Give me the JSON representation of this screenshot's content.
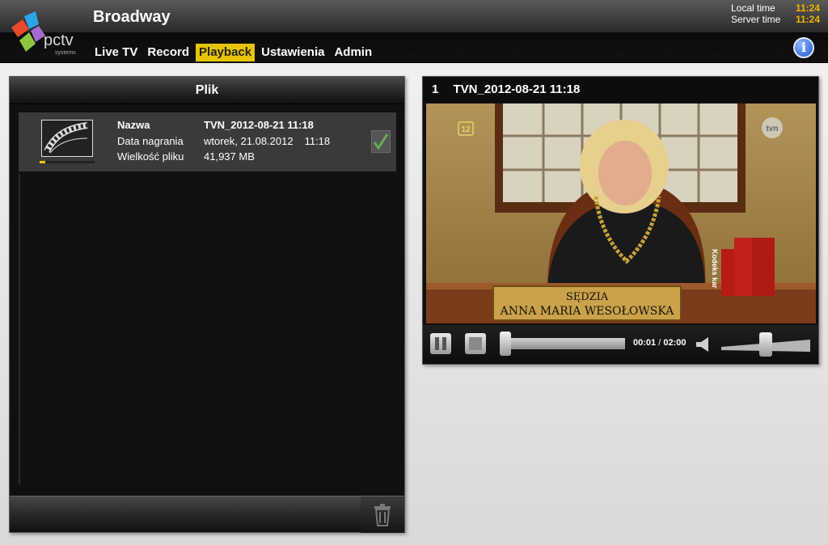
{
  "app": {
    "title": "Broadway",
    "logo_text": "pctv",
    "logo_subtext": "systems"
  },
  "clock": {
    "local_label": "Local time",
    "local_value": "11:24",
    "server_label": "Server time",
    "server_value": "11:24"
  },
  "nav": {
    "items": [
      {
        "label": "Live TV"
      },
      {
        "label": "Record"
      },
      {
        "label": "Playback",
        "active": true
      },
      {
        "label": "Ustawienia"
      },
      {
        "label": "Admin"
      }
    ]
  },
  "file_panel": {
    "title": "Plik",
    "file": {
      "name_label": "Nazwa",
      "name_value": "TVN_2012-08-21 11:18",
      "date_label": "Data nagrania",
      "date_value": "wtorek, 21.08.2012",
      "time_value": "11:18",
      "size_label": "Wielkość pliku",
      "size_value": "41,937 MB",
      "progress": 0.1,
      "checked": true
    }
  },
  "player": {
    "index": "1",
    "title": "TVN_2012-08-21 11:18",
    "channel_logo": "tvn",
    "rating_badge": "12",
    "nameplate_line1": "SĘDZIA",
    "nameplate_line2": "ANNA MARIA WESOŁOWSKA",
    "book_label": "Kodeks kar",
    "elapsed": "00:01",
    "separator": "/",
    "duration": "02:00",
    "seek_fraction": 0.01,
    "volume_fraction": 0.6
  },
  "colors": {
    "accent": "#e8c400",
    "time_value": "#f3b400",
    "panel_bg": "#101010"
  },
  "icons": {
    "info": "info-icon",
    "pause": "pause-icon",
    "stop": "stop-icon",
    "volume": "speaker-icon",
    "delete": "trash-icon",
    "check": "checkmark-icon",
    "thumbnail": "film-icon"
  }
}
